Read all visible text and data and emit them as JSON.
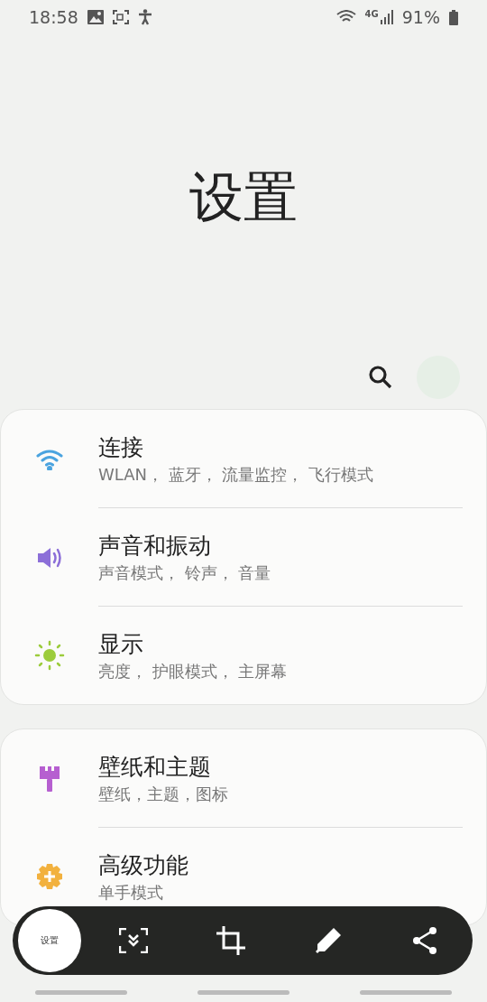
{
  "status_bar": {
    "time": "18:58",
    "network": "4G",
    "battery": "91%"
  },
  "title": "设置",
  "groups": [
    {
      "items": [
        {
          "kind": "wifi",
          "title": "连接",
          "subtitle": "WLAN， 蓝牙， 流量监控， 飞行模式"
        },
        {
          "kind": "sound",
          "title": "声音和振动",
          "subtitle": "声音模式， 铃声， 音量"
        },
        {
          "kind": "display",
          "title": "显示",
          "subtitle": "亮度， 护眼模式， 主屏幕"
        }
      ]
    },
    {
      "items": [
        {
          "kind": "wallpaper",
          "title": "壁纸和主题",
          "subtitle": "壁纸，主题，图标"
        },
        {
          "kind": "advanced",
          "title": "高级功能",
          "subtitle": "单手模式"
        }
      ]
    }
  ],
  "screenshot_toolbar": {
    "thumbnail_text": "设置"
  }
}
